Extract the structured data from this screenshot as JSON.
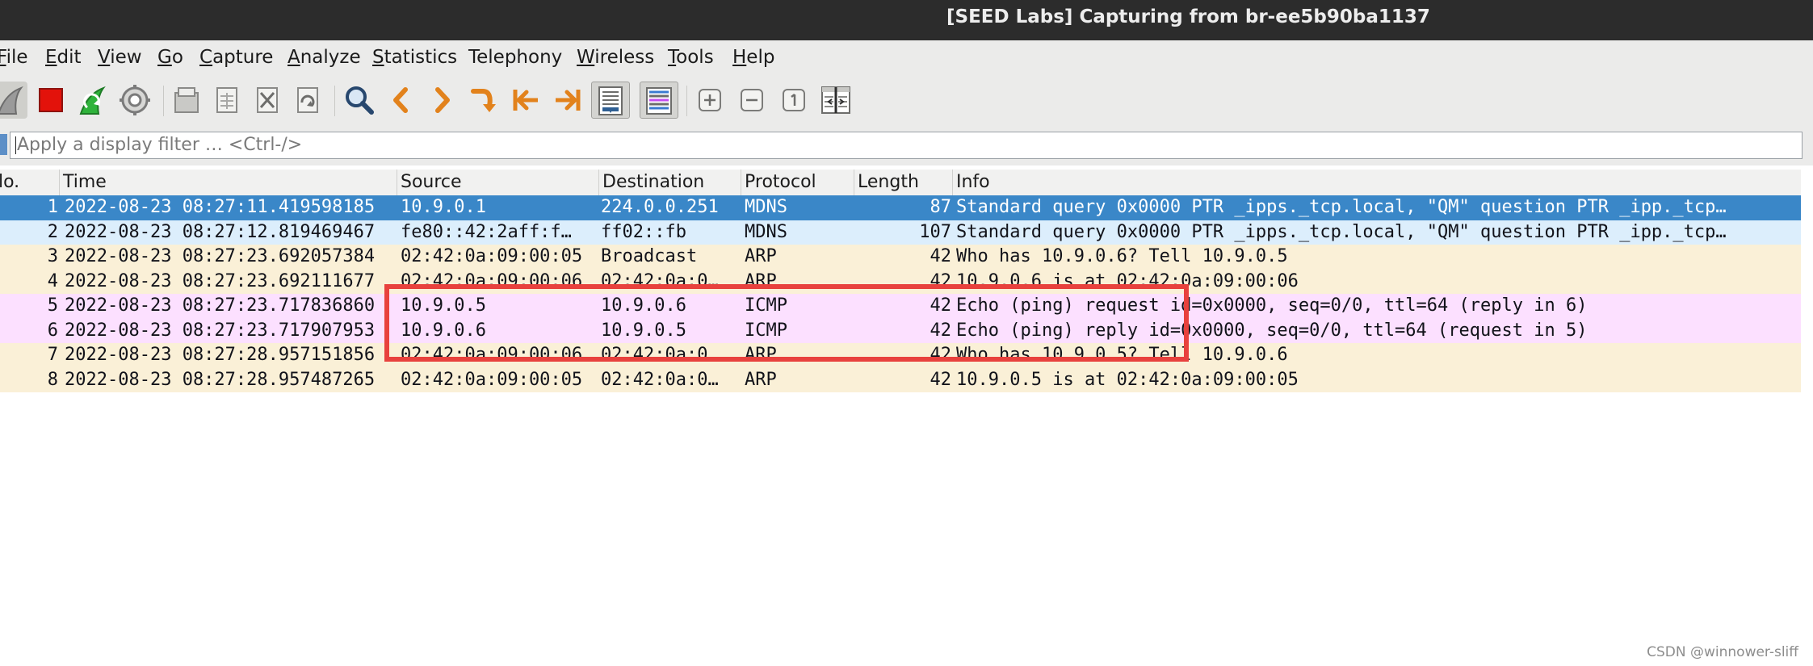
{
  "window": {
    "title": "[SEED Labs] Capturing from br-ee5b90ba1137"
  },
  "menu": [
    {
      "label": "File",
      "mnemonic": "F",
      "rest": "ile"
    },
    {
      "label": "Edit",
      "mnemonic": "E",
      "rest": "dit"
    },
    {
      "label": "View",
      "mnemonic": "V",
      "rest": "iew"
    },
    {
      "label": "Go",
      "mnemonic": "G",
      "rest": "o"
    },
    {
      "label": "Capture",
      "mnemonic": "C",
      "rest": "apture"
    },
    {
      "label": "Analyze",
      "mnemonic": "A",
      "rest": "nalyze"
    },
    {
      "label": "Statistics",
      "mnemonic": "S",
      "rest": "tatistics"
    },
    {
      "label": "Telephony",
      "mnemonic": "",
      "rest": "Telephony"
    },
    {
      "label": "Wireless",
      "mnemonic": "W",
      "rest": "ireless"
    },
    {
      "label": "Tools",
      "mnemonic": "T",
      "rest": "ools"
    },
    {
      "label": "Help",
      "mnemonic": "H",
      "rest": "elp"
    }
  ],
  "toolbar": {
    "icons": [
      "start-capture-icon",
      "stop-capture-icon",
      "restart-capture-icon",
      "capture-options-icon",
      "open-file-icon",
      "save-file-icon",
      "close-file-icon",
      "reload-file-icon",
      "find-packet-icon",
      "go-back-icon",
      "go-forward-icon",
      "go-to-packet-icon",
      "go-first-packet-icon",
      "go-last-packet-icon",
      "auto-scroll-icon",
      "colorize-icon",
      "zoom-in-icon",
      "zoom-out-icon",
      "normal-size-icon",
      "resize-columns-icon"
    ]
  },
  "filter": {
    "placeholder": "Apply a display filter … <Ctrl-/>"
  },
  "columns": {
    "no": "lo.",
    "time": "Time",
    "source": "Source",
    "destination": "Destination",
    "protocol": "Protocol",
    "length": "Length",
    "info": "Info"
  },
  "packets": [
    {
      "no": "1",
      "time": "2022-08-23 08:27:11.419598185",
      "source": "10.9.0.1",
      "destination": "224.0.0.251",
      "protocol": "MDNS",
      "length": "87",
      "info": "Standard query 0x0000 PTR _ipps._tcp.local, \"QM\" question PTR _ipp._tcp…",
      "row_color": "#3a87c8",
      "text_color": "#ffffff"
    },
    {
      "no": "2",
      "time": "2022-08-23 08:27:12.819469467",
      "source": "fe80::42:2aff:f…",
      "destination": "ff02::fb",
      "protocol": "MDNS",
      "length": "107",
      "info": "Standard query 0x0000 PTR _ipps._tcp.local, \"QM\" question PTR _ipp._tcp…",
      "row_color": "#dceefc",
      "text_color": "#12131a"
    },
    {
      "no": "3",
      "time": "2022-08-23 08:27:23.692057384",
      "source": "02:42:0a:09:00:05",
      "destination": "Broadcast",
      "protocol": "ARP",
      "length": "42",
      "info": "Who has 10.9.0.6? Tell 10.9.0.5",
      "row_color": "#faf0d7",
      "text_color": "#12131a"
    },
    {
      "no": "4",
      "time": "2022-08-23 08:27:23.692111677",
      "source": "02:42:0a:09:00:06",
      "destination": "02:42:0a:0…",
      "protocol": "ARP",
      "length": "42",
      "info": "10.9.0.6 is at 02:42:0a:09:00:06",
      "row_color": "#faf0d7",
      "text_color": "#12131a"
    },
    {
      "no": "5",
      "time": "2022-08-23 08:27:23.717836860",
      "source": "10.9.0.5",
      "destination": "10.9.0.6",
      "protocol": "ICMP",
      "length": "42",
      "info": "Echo (ping) request  id=0x0000, seq=0/0, ttl=64 (reply in 6)",
      "row_color": "#fce0ff",
      "text_color": "#12131a"
    },
    {
      "no": "6",
      "time": "2022-08-23 08:27:23.717907953",
      "source": "10.9.0.6",
      "destination": "10.9.0.5",
      "protocol": "ICMP",
      "length": "42",
      "info": "Echo (ping) reply    id=0x0000, seq=0/0, ttl=64 (request in 5)",
      "row_color": "#fce0ff",
      "text_color": "#12131a"
    },
    {
      "no": "7",
      "time": "2022-08-23 08:27:28.957151856",
      "source": "02:42:0a:09:00:06",
      "destination": "02:42:0a:0…",
      "protocol": "ARP",
      "length": "42",
      "info": "Who has 10.9.0.5? Tell 10.9.0.6",
      "row_color": "#faf0d7",
      "text_color": "#12131a"
    },
    {
      "no": "8",
      "time": "2022-08-23 08:27:28.957487265",
      "source": "02:42:0a:09:00:05",
      "destination": "02:42:0a:0…",
      "protocol": "ARP",
      "length": "42",
      "info": "10.9.0.5 is at 02:42:0a:09:00:05",
      "row_color": "#faf0d7",
      "text_color": "#12131a"
    }
  ],
  "watermark": {
    "text": "CSDN @winnower-sliff"
  }
}
